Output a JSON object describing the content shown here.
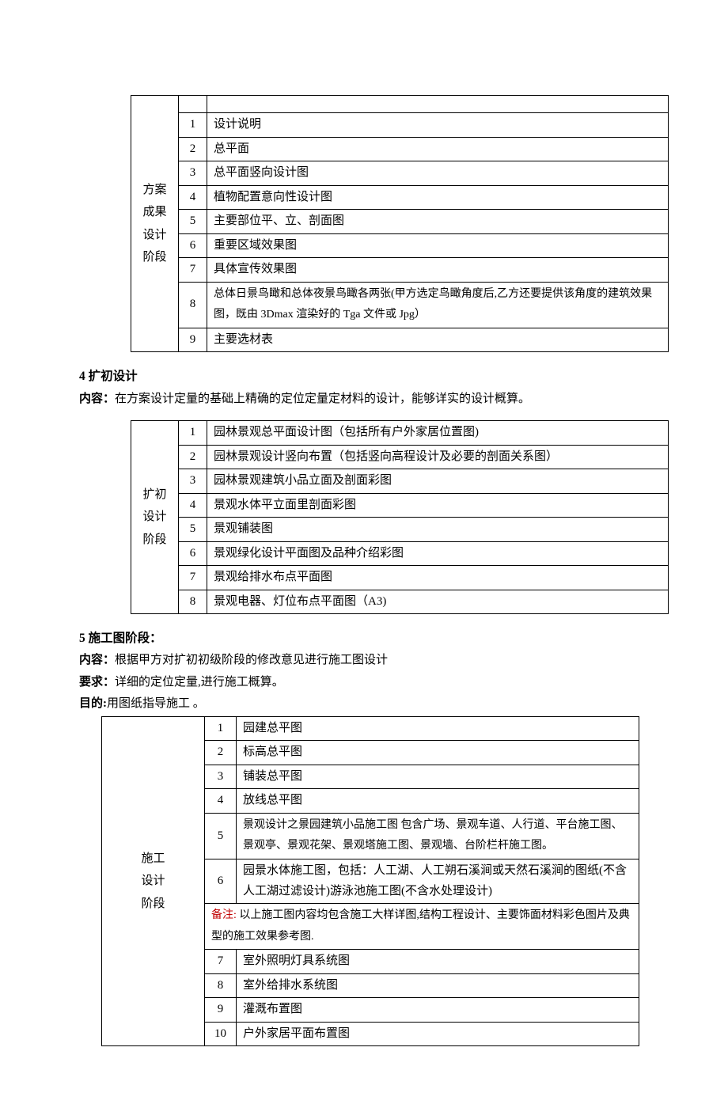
{
  "section1": {
    "stage_lines": [
      "方案",
      "成果",
      "设计",
      "阶段"
    ],
    "rows": [
      {
        "n": "1",
        "c": "设计说明"
      },
      {
        "n": "2",
        "c": "总平面"
      },
      {
        "n": "3",
        "c": "总平面竖向设计图"
      },
      {
        "n": "4",
        "c": "植物配置意向性设计图"
      },
      {
        "n": "5",
        "c": "主要部位平、立、剖面图"
      },
      {
        "n": "6",
        "c": "重要区域效果图"
      },
      {
        "n": "7",
        "c": "具体宣传效果图"
      },
      {
        "n": "8",
        "c": "总体日景鸟瞰和总体夜景鸟瞰各两张(甲方选定鸟瞰角度后,乙方还要提供该角度的建筑效果图，既由 3Dmax 渲染好的 Tga 文件或 Jpg）"
      },
      {
        "n": "9",
        "c": "主要选材表"
      }
    ]
  },
  "section2": {
    "heading": "4 扩初设计",
    "intro_label": "内容：",
    "intro_text": "在方案设计定量的基础上精确的定位定量定材料的设计，能够详实的设计概算。",
    "stage_lines": [
      "扩初",
      "设计",
      "阶段"
    ],
    "rows": [
      {
        "n": "1",
        "c": "园林景观总平面设计图（包括所有户外家居位置图)"
      },
      {
        "n": "2",
        "c": "园林景观设计竖向布置（包括竖向高程设计及必要的剖面关系图）"
      },
      {
        "n": "3",
        "c": "园林景观建筑小品立面及剖面彩图"
      },
      {
        "n": "4",
        "c": "景观水体平立面里剖面彩图"
      },
      {
        "n": "5",
        "c": "景观铺装图"
      },
      {
        "n": "6",
        "c": "景观绿化设计平面图及品种介绍彩图"
      },
      {
        "n": "7",
        "c": "景观给排水布点平面图"
      },
      {
        "n": "8",
        "c": "景观电器、灯位布点平面图（A3)"
      }
    ]
  },
  "section3": {
    "heading": "5 施工图阶段：",
    "p1_label": "内容：",
    "p1_text": "根据甲方对扩初初级阶段的修改意见进行施工图设计",
    "p2_label": "要求：",
    "p2_text": "详细的定位定量,进行施工概算。",
    "p3_label": "目的:",
    "p3_text": "用图纸指导施工 。",
    "stage_lines": [
      "施工",
      "设计",
      "阶段"
    ],
    "rows_a": [
      {
        "n": "1",
        "c": "园建总平图"
      },
      {
        "n": "2",
        "c": "标高总平图"
      },
      {
        "n": "3",
        "c": "铺装总平图"
      },
      {
        "n": "4",
        "c": "放线总平图"
      },
      {
        "n": "5",
        "c": "景观设计之景园建筑小品施工图 包含广场、景观车道、人行道、平台施工图、景观亭、景观花架、景观塔施工图、景观墙、台阶栏杆施工图。"
      },
      {
        "n": "6",
        "c": "园景水体施工图，包括：人工湖、人工朔石溪涧或天然石溪涧的图纸(不含人工湖过滤设计)游泳池施工图(不含水处理设计)"
      }
    ],
    "note_label": "备注:",
    "note_text": " 以上施工图内容均包含施工大样详图,结构工程设计、主要饰面材料彩色图片及典型的施工效果参考图.",
    "rows_b": [
      {
        "n": "7",
        "c": "室外照明灯具系统图"
      },
      {
        "n": "8",
        "c": "室外给排水系统图"
      },
      {
        "n": "9",
        "c": "灌溉布置图"
      },
      {
        "n": "10",
        "c": "户外家居平面布置图"
      }
    ]
  }
}
